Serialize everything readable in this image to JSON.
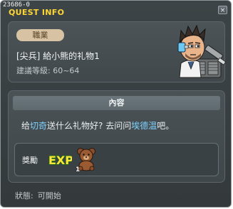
{
  "header": {
    "quest_id": "23686-0",
    "title": "QUEST INFO",
    "close_label": "×"
  },
  "job_panel": {
    "badge": "職業",
    "quest_title": "[尖兵] 給小熊的礼物1",
    "level_label": "建議等級: 60~64"
  },
  "content_panel": {
    "header": "內容",
    "text_parts": [
      "给",
      "切奇",
      "送什么礼物好? 去问问",
      "埃德温",
      "吧。"
    ],
    "highlight_color": "#7fd3ff"
  },
  "reward": {
    "label": "獎勵",
    "exp_label": "EXP",
    "item_count": "1",
    "items": [
      "exp-icon",
      "teddy-bear-icon"
    ]
  },
  "status": {
    "label": "狀態:",
    "value": "可開始"
  },
  "colors": {
    "title": "#ffd735",
    "badge": "#d7c2a3",
    "panel": "#4a5256"
  }
}
